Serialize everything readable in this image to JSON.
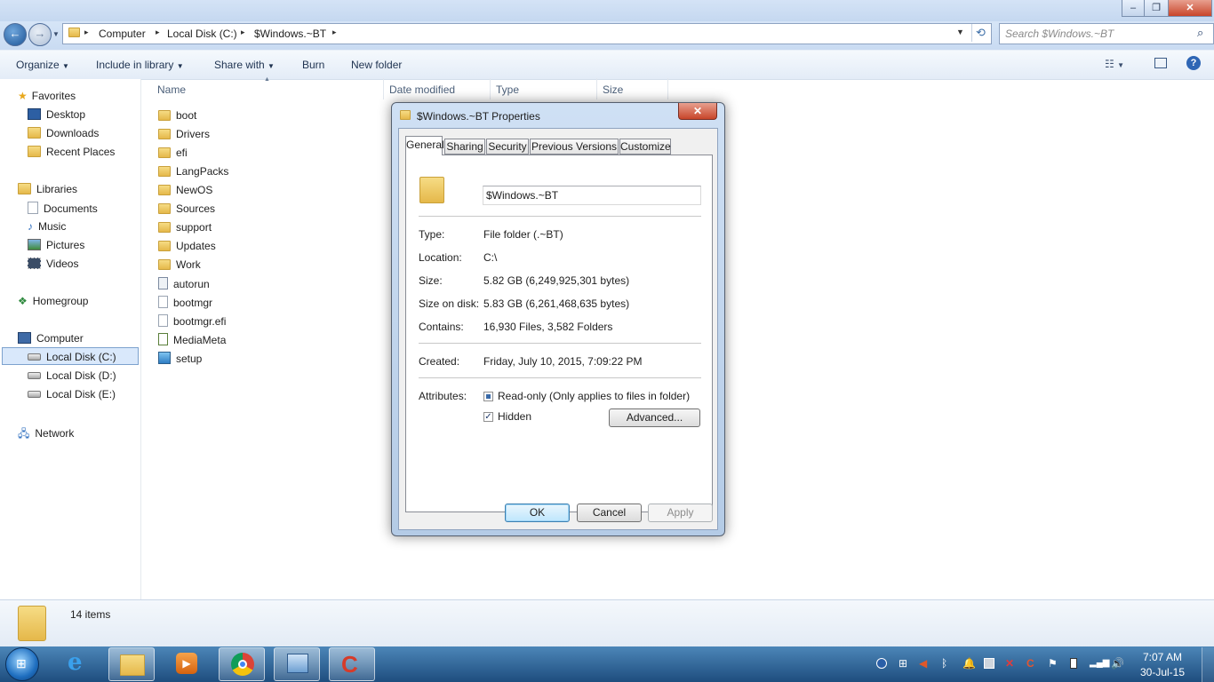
{
  "window": {
    "controls": {
      "minimize": "–",
      "maximize": "❐",
      "close": "✕"
    }
  },
  "address_bar": {
    "crumbs": [
      "Computer",
      "Local Disk (C:)",
      "$Windows.~BT"
    ],
    "search_placeholder": "Search $Windows.~BT"
  },
  "toolbar": {
    "items": [
      "Organize",
      "Include in library",
      "Share with",
      "Burn",
      "New folder"
    ]
  },
  "navpane": {
    "favorites": {
      "label": "Favorites",
      "items": [
        "Desktop",
        "Downloads",
        "Recent Places"
      ]
    },
    "libraries": {
      "label": "Libraries",
      "items": [
        "Documents",
        "Music",
        "Pictures",
        "Videos"
      ]
    },
    "homegroup": "Homegroup",
    "computer": {
      "label": "Computer",
      "items": [
        "Local Disk (C:)",
        "Local Disk (D:)",
        "Local Disk (E:)"
      ]
    },
    "network": "Network"
  },
  "columns": [
    "Name",
    "Date modified",
    "Type",
    "Size"
  ],
  "files": [
    {
      "name": "boot",
      "icon": "folder-icon"
    },
    {
      "name": "Drivers",
      "icon": "folder-icon"
    },
    {
      "name": "efi",
      "icon": "folder-icon"
    },
    {
      "name": "LangPacks",
      "icon": "folder-icon"
    },
    {
      "name": "NewOS",
      "icon": "folder-icon"
    },
    {
      "name": "Sources",
      "icon": "folder-icon"
    },
    {
      "name": "support",
      "icon": "folder-icon"
    },
    {
      "name": "Updates",
      "icon": "folder-icon"
    },
    {
      "name": "Work",
      "icon": "folder-icon"
    },
    {
      "name": "autorun",
      "icon": "settings-file-icon"
    },
    {
      "name": "bootmgr",
      "icon": "file-icon"
    },
    {
      "name": "bootmgr.efi",
      "icon": "file-icon"
    },
    {
      "name": "MediaMeta",
      "icon": "xml-file-icon"
    },
    {
      "name": "setup",
      "icon": "setup-icon"
    }
  ],
  "status": {
    "items_count": "14 items"
  },
  "dialog": {
    "title": "$Windows.~BT Properties",
    "tabs": [
      "General",
      "Sharing",
      "Security",
      "Previous Versions",
      "Customize"
    ],
    "active_tab": "General",
    "folder_name": "$Windows.~BT",
    "props": {
      "type_label": "Type:",
      "type_value": "File folder (.~BT)",
      "location_label": "Location:",
      "location_value": "C:\\",
      "size_label": "Size:",
      "size_value": "5.82 GB (6,249,925,301 bytes)",
      "size_on_disk_label": "Size on disk:",
      "size_on_disk_value": "5.83 GB (6,261,468,635 bytes)",
      "contains_label": "Contains:",
      "contains_value": "16,930 Files, 3,582 Folders",
      "created_label": "Created:",
      "created_value": "Friday, July 10, 2015, 7:09:22 PM"
    },
    "attributes": {
      "label": "Attributes:",
      "readonly_label": "Read-only (Only applies to files in folder)",
      "readonly_state": "indeterminate",
      "hidden_label": "Hidden",
      "hidden_state": "checked",
      "advanced_button": "Advanced..."
    },
    "buttons": {
      "ok": "OK",
      "cancel": "Cancel",
      "apply": "Apply"
    }
  },
  "taskbar": {
    "time": "7:07 AM",
    "date": "30-Jul-15"
  }
}
